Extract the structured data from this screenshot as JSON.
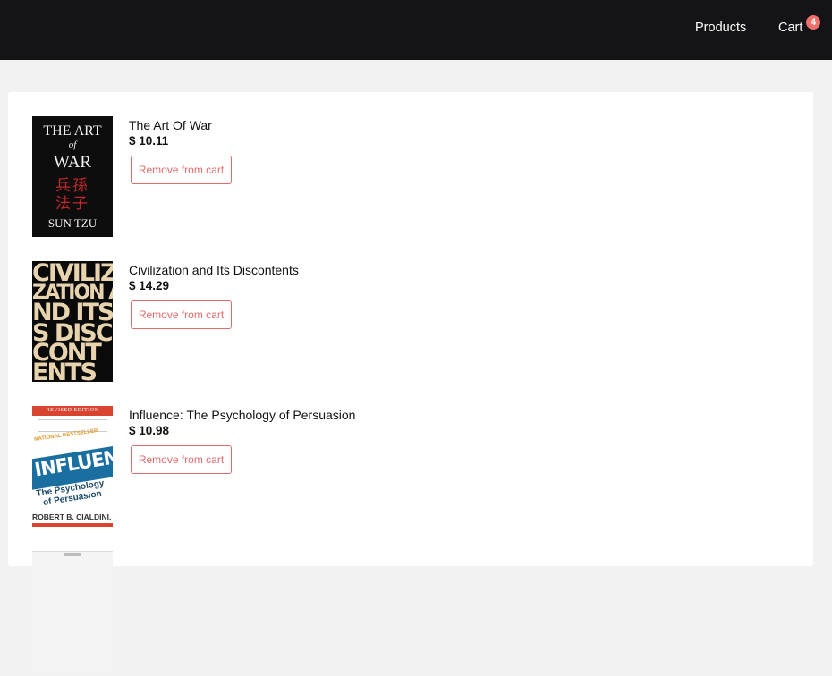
{
  "nav": {
    "products_label": "Products",
    "cart_label": "Cart",
    "cart_count": "4"
  },
  "cart": {
    "remove_label": "Remove from cart",
    "items": [
      {
        "title": "The Art Of War",
        "price": "$ 10.11",
        "cover_text": [
          "THE ART",
          "of",
          "WAR",
          "兵孫",
          "法子",
          "SUN TZU"
        ]
      },
      {
        "title": "Civilization and Its Discontents",
        "price": "$ 14.29",
        "cover_text": [
          "CIVILIZ",
          "ZATION AN",
          "ND ITS",
          "S DISC",
          "CONT",
          "ENTS"
        ]
      },
      {
        "title": "Influence: The Psychology of Persuasion",
        "price": "$ 10.98",
        "cover_text": [
          "REVISED EDITION",
          "NATIONAL BESTSELLER",
          "INFLUENCE",
          "The Psychology",
          "of Persuasion",
          "ROBERT B. CIALDINI, PH.D."
        ]
      }
    ]
  },
  "colors": {
    "topbar": "#141416",
    "accent": "#e06b6b",
    "badge": "#ef6e6e",
    "page_bg": "#f2f2f2"
  }
}
